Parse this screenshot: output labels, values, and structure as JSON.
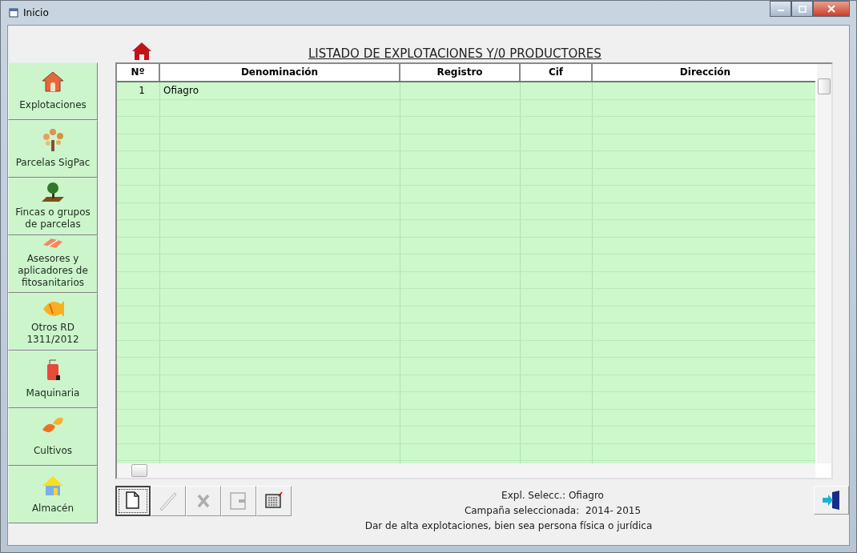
{
  "window": {
    "title": "Inicio"
  },
  "heading": "LISTADO DE EXPLOTACIONES Y/0 PRODUCTORES",
  "sidebar": {
    "items": [
      {
        "label": "Explotaciones"
      },
      {
        "label": "Parcelas SigPac"
      },
      {
        "label": "Fincas o grupos de parcelas"
      },
      {
        "label": "Asesores y aplicadores de fitosanitarios"
      },
      {
        "label": "Otros RD 1311/2012"
      },
      {
        "label": "Maquinaria"
      },
      {
        "label": "Cultivos"
      },
      {
        "label": "Almacén"
      }
    ]
  },
  "table": {
    "columns": [
      "Nº",
      "Denominación",
      "Registro",
      "Cif",
      "Dirección"
    ],
    "rows": [
      {
        "cells": [
          "1",
          "Ofiagro"
        ]
      }
    ]
  },
  "toolbar": [
    {
      "kind": "new",
      "disabled": false,
      "selected": true
    },
    {
      "kind": "edit",
      "disabled": true,
      "selected": false
    },
    {
      "kind": "delete",
      "disabled": true,
      "selected": false
    },
    {
      "kind": "export",
      "disabled": true,
      "selected": false
    },
    {
      "kind": "calculator",
      "disabled": false,
      "selected": false
    }
  ],
  "status": [
    "Expl. Selecc.: Ofiagro",
    "Campaña seleccionada:  2014- 2015",
    "Dar de alta explotaciones, bien sea persona física o jurídica"
  ]
}
